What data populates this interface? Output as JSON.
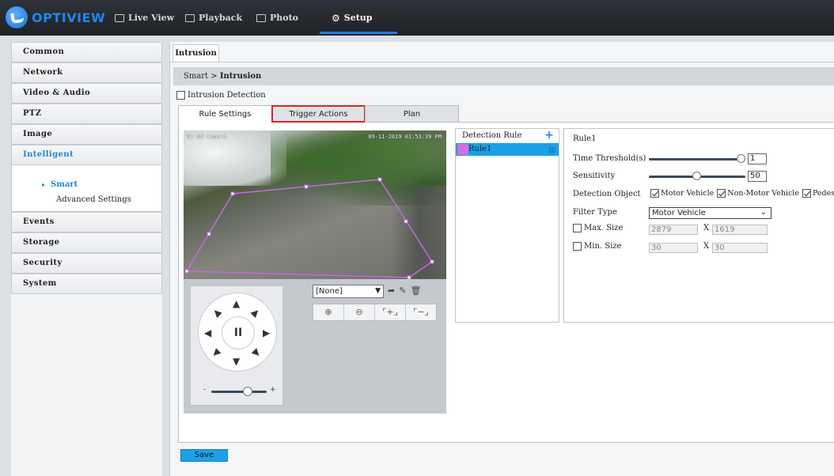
{
  "brand": {
    "logo_text": "OPTIVIEW",
    "color": "#1f86f0"
  },
  "nav": {
    "live_view": "Live View",
    "playback": "Playback",
    "photo": "Photo",
    "setup": "Setup",
    "active": "Setup",
    "accent": "#1d7fd8"
  },
  "sidebar": {
    "items": [
      {
        "label": "Common"
      },
      {
        "label": "Network"
      },
      {
        "label": "Video & Audio"
      },
      {
        "label": "PTZ"
      },
      {
        "label": "Image"
      },
      {
        "label": "Intelligent",
        "active": true
      },
      {
        "label": "Events"
      },
      {
        "label": "Storage"
      },
      {
        "label": "Security"
      },
      {
        "label": "System"
      }
    ],
    "intelligent_sub": [
      {
        "label": "Smart",
        "active": true
      },
      {
        "label": "Advanced Settings"
      }
    ]
  },
  "page": {
    "tab": "Intrusion",
    "breadcrumb_root": "Smart",
    "breadcrumb_sep": " > ",
    "breadcrumb_current": "Intrusion",
    "intrusion_detection_label": "Intrusion Detection",
    "intrusion_detection_checked": false
  },
  "subtabs": [
    {
      "label": "Rule Settings",
      "active": true
    },
    {
      "label": "Trigger Actions",
      "highlighted": true,
      "highlight_color": "#e0232b"
    },
    {
      "label": "Plan"
    }
  ],
  "video": {
    "osd_left": "01  NW Camera",
    "osd_time": "09-11-2019 01:53:39 PM",
    "region_color": "#c768e0"
  },
  "ptz": {
    "pause_glyph": "II",
    "zoom_minus": "-",
    "zoom_plus": "+",
    "zoom_level": 0.65,
    "preset_value": "[None]",
    "preset_icons": [
      "go-arrow-icon",
      "edit-pencil-icon",
      "trash-icon"
    ],
    "zoom_buttons": [
      "zoom-in-icon",
      "zoom-out-icon",
      "focus-near-icon",
      "focus-far-icon"
    ]
  },
  "detection_rule": {
    "header": "Detection Rule",
    "add_glyph": "+",
    "rules": [
      {
        "name": "Rule1",
        "color": "#d36fe0",
        "selected": true
      }
    ],
    "selected_color": "#1ba1e6"
  },
  "rule_settings": {
    "title": "Rule1",
    "time_threshold_label": "Time Threshold(s)",
    "time_threshold_value": "1",
    "time_threshold_level": 0.95,
    "sensitivity_label": "Sensitivity",
    "sensitivity_value": "50",
    "sensitivity_level": 0.5,
    "detection_object_label": "Detection Object",
    "objects": [
      {
        "label": "Motor Vehicle",
        "checked": true
      },
      {
        "label": "Non-Motor Vehicle",
        "checked": true
      },
      {
        "label": "Pedestrian",
        "checked": true
      }
    ],
    "filter_type_label": "Filter Type",
    "filter_type_value": "Motor Vehicle",
    "max_size_label": "Max. Size",
    "max_size_w": "2879",
    "max_size_h": "1619",
    "min_size_label": "Min. Size",
    "min_size_w": "30",
    "min_size_h": "30",
    "x_label": "X"
  },
  "actions": {
    "save": "Save"
  }
}
